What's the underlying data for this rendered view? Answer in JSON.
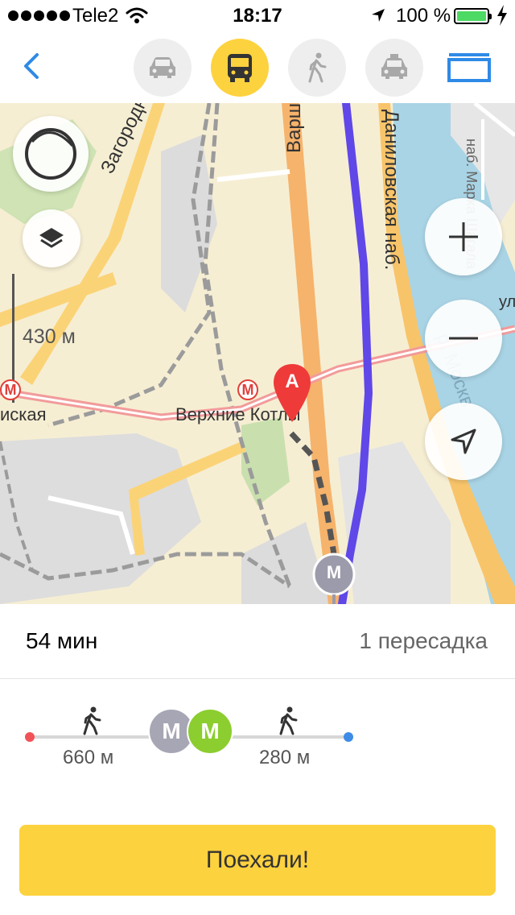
{
  "status_bar": {
    "carrier": "Tele2",
    "time": "18:17",
    "battery": "100 %"
  },
  "nav": {
    "modes": [
      {
        "name": "car",
        "active": false
      },
      {
        "name": "transit",
        "active": true
      },
      {
        "name": "walk",
        "active": false
      },
      {
        "name": "taxi",
        "active": false
      }
    ]
  },
  "map": {
    "scale_label": "430 м",
    "streets": [
      "Загородно",
      "Варш",
      "Даниловская наб.",
      "наб. Марка Шагала",
      "ул",
      "р. Москв"
    ],
    "metro_stations": [
      "иская",
      "Верхние Котлы"
    ],
    "start_marker": "A",
    "metro_marker": "M"
  },
  "route": {
    "duration": "54 мин",
    "transfers": "1 пересадка"
  },
  "segments": {
    "walk_start": "660 м",
    "walk_end": "280 м",
    "metro_1": "M",
    "metro_2": "M",
    "colors": {
      "metro_1": "#a6a6b4",
      "metro_2": "#8ccd2f"
    }
  },
  "actions": {
    "go_label": "Поехали!"
  },
  "colors": {
    "accent": "#fdd23f",
    "route_line": "#5f47e8",
    "back_blue": "#2e8ae6"
  }
}
